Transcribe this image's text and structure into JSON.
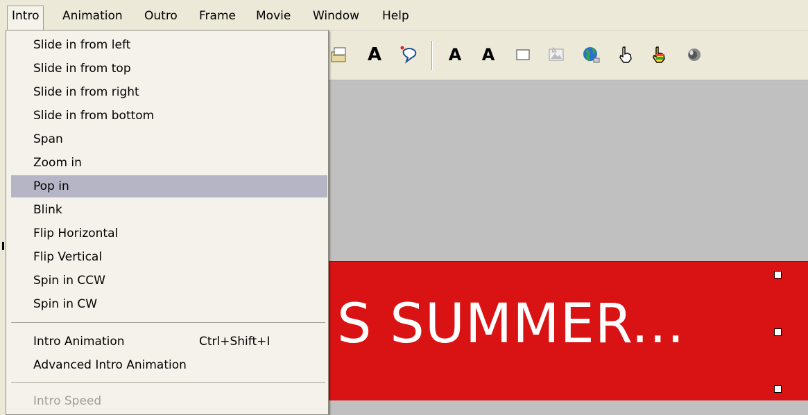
{
  "menubar": {
    "items": [
      "Intro",
      "Animation",
      "Outro",
      "Frame",
      "Movie",
      "Window",
      "Help"
    ],
    "open_index": 0
  },
  "dropdown": {
    "items": [
      {
        "label": "Slide in from left"
      },
      {
        "label": "Slide in from top"
      },
      {
        "label": "Slide in from right"
      },
      {
        "label": "Slide in from bottom"
      },
      {
        "label": "Span"
      },
      {
        "label": "Zoom in"
      },
      {
        "label": "Pop in",
        "highlighted": true
      },
      {
        "label": "Blink"
      },
      {
        "label": "Flip Horizontal"
      },
      {
        "label": "Flip Vertical"
      },
      {
        "label": "Spin in CCW"
      },
      {
        "label": "Spin in CW"
      }
    ],
    "group2": [
      {
        "label": "Intro Animation",
        "shortcut": "Ctrl+Shift+I"
      },
      {
        "label": "Advanced Intro Animation"
      }
    ],
    "group3": [
      {
        "label": "Intro Speed",
        "disabled": true
      }
    ]
  },
  "toolbar": {
    "icons": [
      "properties-icon",
      "text-icon",
      "callout-icon",
      "text-effect-up-icon",
      "text-effect-down-icon",
      "rectangle-icon",
      "image-icon",
      "globe-icon",
      "hand-pointer-icon",
      "hand-color-icon",
      "speaker-icon"
    ],
    "text_glyph": "A",
    "effect_glyph": "A"
  },
  "canvas": {
    "banner_text": "S SUMMER...",
    "banner_color": "#d91313",
    "background_color": "#c0c0c0"
  },
  "colors": {
    "menu_highlight": "#b6b5c6",
    "chrome": "#ece9d8"
  }
}
